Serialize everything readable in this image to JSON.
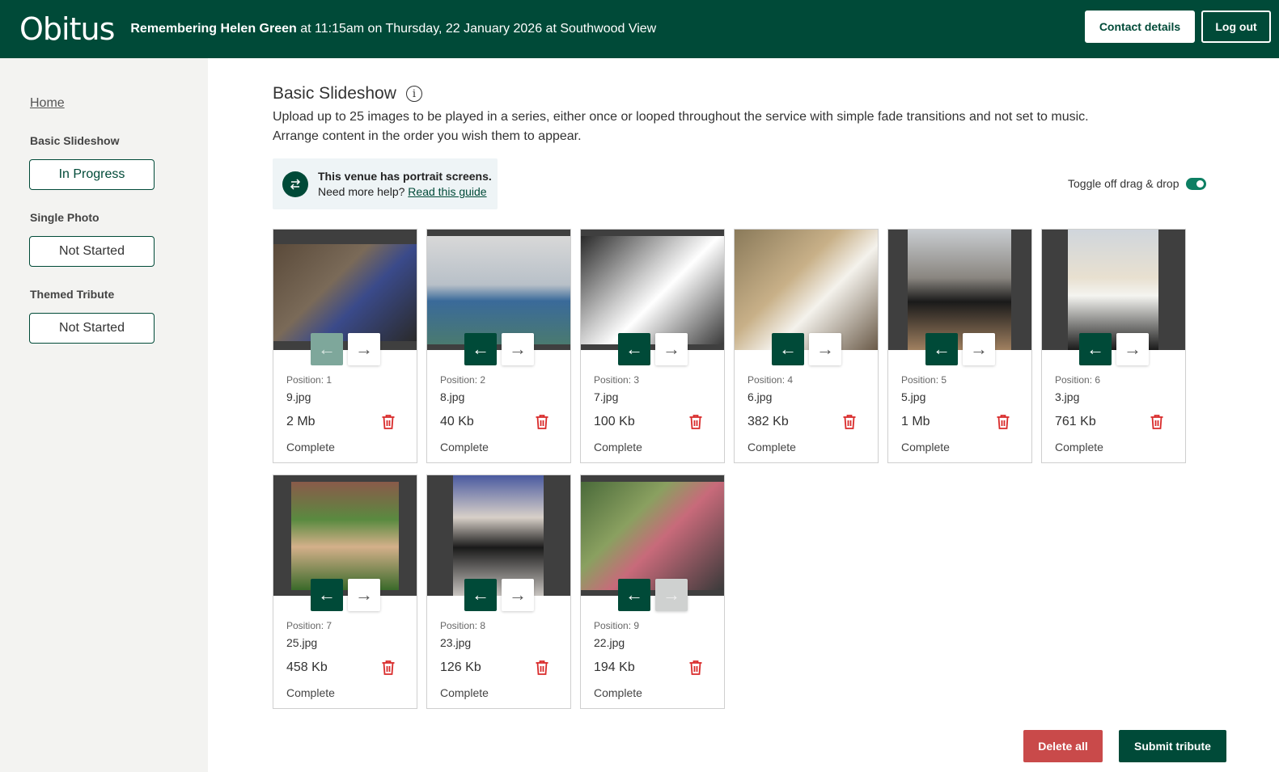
{
  "header": {
    "logo": "Obitus",
    "title_bold": "Remembering Helen Green",
    "title_rest": " at 11:15am on Thursday, 22 January 2026 at Southwood View",
    "contact_label": "Contact details",
    "logout_label": "Log out"
  },
  "sidebar": {
    "home": "Home",
    "sections": [
      {
        "label": "Basic Slideshow",
        "status": "In Progress"
      },
      {
        "label": "Single Photo",
        "status": "Not Started"
      },
      {
        "label": "Themed Tribute",
        "status": "Not Started"
      }
    ]
  },
  "main": {
    "title": "Basic Slideshow",
    "info_glyph": "i",
    "desc_line1": "Upload up to 25 images to be played in a series, either once or looped throughout the service with simple fade transitions and not set to music.",
    "desc_line2": "Arrange content in the order you wish them to appear.",
    "notice_title": "This venue has portrait screens.",
    "notice_help": "Need more help?",
    "notice_link": "Read this guide",
    "toggle_label": "Toggle off drag & drop",
    "toggle_on": true
  },
  "cards": [
    {
      "position": "Position: 1",
      "file": "9.jpg",
      "size": "2 Mb",
      "status": "Complete",
      "left_disabled": true,
      "right_disabled": false
    },
    {
      "position": "Position: 2",
      "file": "8.jpg",
      "size": "40 Kb",
      "status": "Complete",
      "left_disabled": false,
      "right_disabled": false
    },
    {
      "position": "Position: 3",
      "file": "7.jpg",
      "size": "100 Kb",
      "status": "Complete",
      "left_disabled": false,
      "right_disabled": false
    },
    {
      "position": "Position: 4",
      "file": "6.jpg",
      "size": "382 Kb",
      "status": "Complete",
      "left_disabled": false,
      "right_disabled": false
    },
    {
      "position": "Position: 5",
      "file": "5.jpg",
      "size": "1 Mb",
      "status": "Complete",
      "left_disabled": false,
      "right_disabled": false
    },
    {
      "position": "Position: 6",
      "file": "3.jpg",
      "size": "761 Kb",
      "status": "Complete",
      "left_disabled": false,
      "right_disabled": false
    },
    {
      "position": "Position: 7",
      "file": "25.jpg",
      "size": "458 Kb",
      "status": "Complete",
      "left_disabled": false,
      "right_disabled": false
    },
    {
      "position": "Position: 8",
      "file": "23.jpg",
      "size": "126 Kb",
      "status": "Complete",
      "left_disabled": false,
      "right_disabled": false
    },
    {
      "position": "Position: 9",
      "file": "22.jpg",
      "size": "194 Kb",
      "status": "Complete",
      "left_disabled": false,
      "right_disabled": true
    }
  ],
  "icons": {
    "left_arrow": "arrow-left-icon",
    "right_arrow": "arrow-right-icon",
    "trash": "trash-icon",
    "swap": "swap-icon",
    "info": "info-icon"
  },
  "colors": {
    "brand": "#004a38",
    "danger": "#c94a4a",
    "trash": "#d92b2b",
    "toggle": "#0d7f63"
  },
  "footer": {
    "delete_all": "Delete all",
    "submit": "Submit tribute"
  }
}
